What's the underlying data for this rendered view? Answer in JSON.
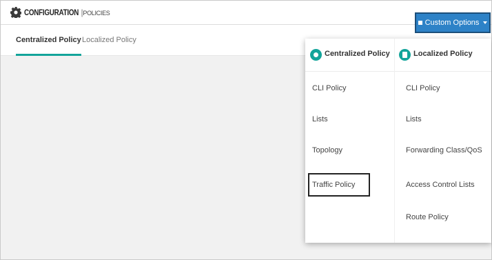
{
  "header": {
    "title": "CONFIGURATION",
    "separator": "|",
    "subtitle": "POLICIES",
    "custom_options_label": "Custom Options"
  },
  "tabs": [
    {
      "label": "Centralized Policy",
      "active": true
    },
    {
      "label": "Localized Policy",
      "active": false
    }
  ],
  "dropdown": {
    "centralized": {
      "title": "Centralized Policy",
      "items": [
        "CLI Policy",
        "Lists",
        "Topology",
        "Traffic Policy"
      ],
      "highlighted": "Traffic Policy"
    },
    "localized": {
      "title": "Localized Policy",
      "items": [
        "CLI Policy",
        "Lists",
        "Forwarding Class/QoS",
        "Access Control Lists",
        "Route Policy"
      ]
    }
  },
  "colors": {
    "accent": "#13a49a",
    "button": "#2d82c7",
    "content_bg": "#f1f1f1"
  }
}
